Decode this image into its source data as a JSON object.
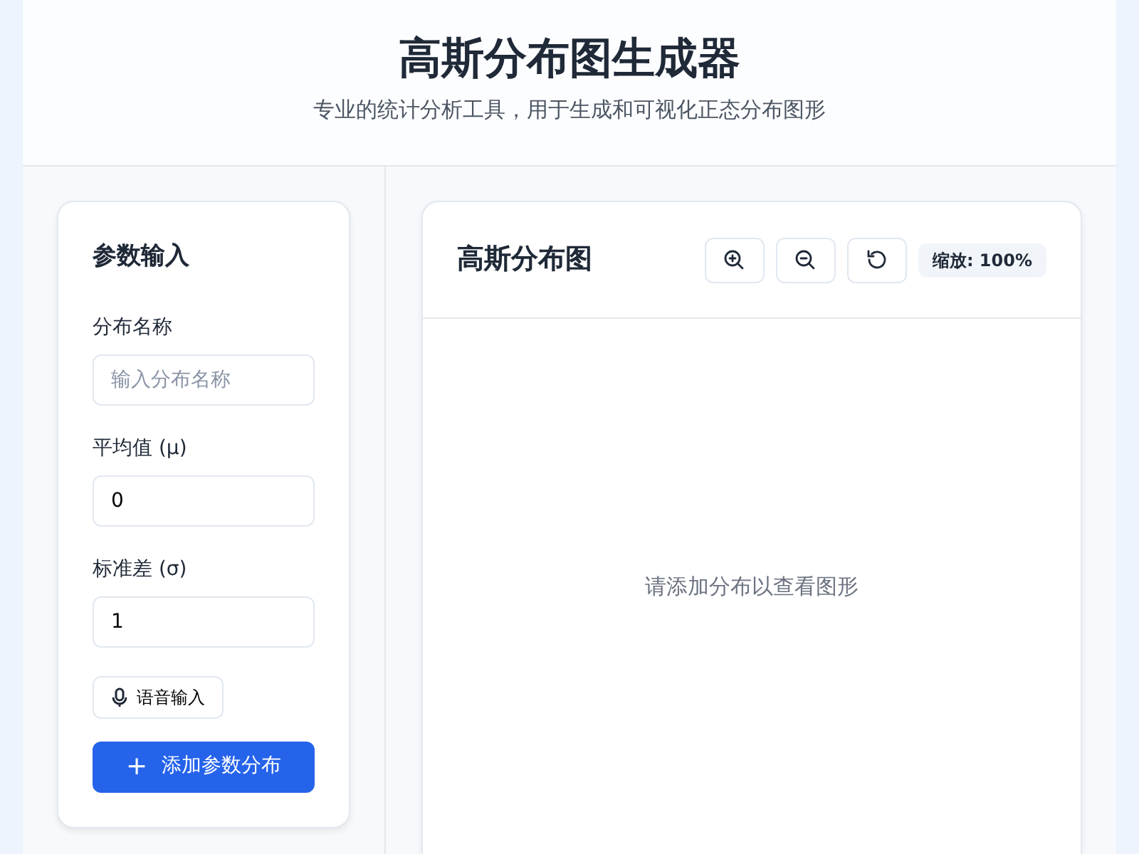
{
  "header": {
    "title": "高斯分布图生成器",
    "subtitle": "专业的统计分析工具，用于生成和可视化正态分布图形"
  },
  "params": {
    "title": "参数输入",
    "fields": [
      {
        "label": "分布名称",
        "placeholder": "输入分布名称"
      },
      {
        "label": "平均值 (μ)",
        "value": "0"
      },
      {
        "label": "标准差 (σ)",
        "value": "1"
      }
    ],
    "voice_button": "语音输入",
    "add_button": {
      "icon": "+",
      "label": "添加参数分布"
    }
  },
  "chart": {
    "title": "高斯分布图",
    "zoom_label": "缩放: 100%",
    "empty_text": "请添加分布以查看图形"
  }
}
